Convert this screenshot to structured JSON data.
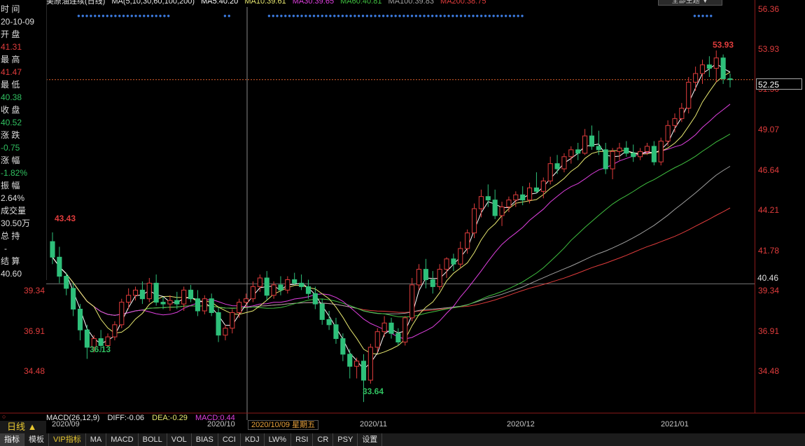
{
  "title": "美原油连续(日线)",
  "ma_legend": {
    "main": "MA(5,10,30,60,100,200)",
    "ma5": "MA5:40.20",
    "ma10": "MA10:39.61",
    "ma30": "MA30:39.65",
    "ma60": "MA60:40.81",
    "ma100": "MA100:39.83",
    "ma200": "MA200:38.75",
    "colors": {
      "ma5": "#ffffff",
      "ma10": "#e8e870",
      "ma30": "#e040e0",
      "ma60": "#40c040",
      "ma100": "#a0a0a0",
      "ma200": "#e03c3c"
    }
  },
  "theme_button": "全部主题 ▼",
  "info": {
    "time_label": "时 间",
    "time_value": "20-10-09",
    "open_label": "开 盘",
    "open_value": "41.31",
    "high_label": "最 高",
    "high_value": "41.47",
    "low_label": "最 低",
    "low_value": "40.38",
    "close_label": "收 盘",
    "close_value": "40.52",
    "change_label": "涨 跌",
    "change_value": "-0.75",
    "pct_label": "涨 幅",
    "pct_value": "-1.82%",
    "amp_label": "振 幅",
    "amp_value": "2.64%",
    "volume_label": "成交量",
    "volume_value": "30.50万",
    "oi_label": "总 持",
    "oi_value": "-",
    "settle_label": "结 算",
    "settle_value": "40.60"
  },
  "y_axis_right": [
    "56.36",
    "53.93",
    "51.50",
    "49.07",
    "46.64",
    "44.21",
    "41.78",
    "39.34",
    "36.91",
    "34.48"
  ],
  "y_axis_left": [
    "39.34",
    "36.91",
    "34.48"
  ],
  "current_price": "52.25",
  "reference_price": "40.46",
  "peak_labels": {
    "high_left": "43.43",
    "low_left": "36.13",
    "low_mid": "33.64",
    "high_right": "53.93"
  },
  "macd": {
    "label": "MACD(26,12,9)",
    "diff": "DIFF:-0.06",
    "dea": "DEA:-0.29",
    "macd": "MACD:0.44"
  },
  "x_axis": [
    "2020/09",
    "2020/10",
    "2020/11",
    "2020/12",
    "2021/01"
  ],
  "cursor_date": "2020/10/09 星期五",
  "period_button": "日线 ▲",
  "bottom_tabs": [
    "指标",
    "模板",
    "VIP指标",
    "MA",
    "MACD",
    "BOLL",
    "VOL",
    "BIAS",
    "CCI",
    "KDJ",
    "LW%",
    "RSI",
    "CR",
    "PSY",
    "设置"
  ],
  "chart_data": {
    "type": "candlestick",
    "title": "美原油连续(日线)",
    "ylim": [
      33.0,
      56.36
    ],
    "candles": [
      [
        42.9,
        43.43,
        41.6,
        42.0
      ],
      [
        42.0,
        42.6,
        40.5,
        40.9
      ],
      [
        40.9,
        41.1,
        39.8,
        40.2
      ],
      [
        40.2,
        40.5,
        38.6,
        39.0
      ],
      [
        39.0,
        39.3,
        37.2,
        37.8
      ],
      [
        37.8,
        38.1,
        36.13,
        36.8
      ],
      [
        36.8,
        37.5,
        36.5,
        37.3
      ],
      [
        37.3,
        37.8,
        36.6,
        36.9
      ],
      [
        36.9,
        37.6,
        36.8,
        37.4
      ],
      [
        37.4,
        38.3,
        37.2,
        38.1
      ],
      [
        38.1,
        39.6,
        37.9,
        39.4
      ],
      [
        39.4,
        40.2,
        39.0,
        39.8
      ],
      [
        39.8,
        40.3,
        39.5,
        40.1
      ],
      [
        40.1,
        40.6,
        39.3,
        39.6
      ],
      [
        39.6,
        40.8,
        39.4,
        40.5
      ],
      [
        40.5,
        41.0,
        39.2,
        39.4
      ],
      [
        39.4,
        39.7,
        39.0,
        39.3
      ],
      [
        39.3,
        39.8,
        38.9,
        39.5
      ],
      [
        39.5,
        40.0,
        39.0,
        39.3
      ],
      [
        39.3,
        40.3,
        38.9,
        40.1
      ],
      [
        40.1,
        40.4,
        39.4,
        39.6
      ],
      [
        39.6,
        40.1,
        38.6,
        38.9
      ],
      [
        38.9,
        39.8,
        38.7,
        39.6
      ],
      [
        39.6,
        39.9,
        38.6,
        38.8
      ],
      [
        38.8,
        39.1,
        37.1,
        37.5
      ],
      [
        37.5,
        38.1,
        37.2,
        37.9
      ],
      [
        37.9,
        39.0,
        37.6,
        38.8
      ],
      [
        38.8,
        39.6,
        38.5,
        39.4
      ],
      [
        39.4,
        39.9,
        39.1,
        39.6
      ],
      [
        39.6,
        40.6,
        39.4,
        40.3
      ],
      [
        40.3,
        41.0,
        40.0,
        40.8
      ],
      [
        40.8,
        41.2,
        39.5,
        39.8
      ],
      [
        39.8,
        40.6,
        39.6,
        40.4
      ],
      [
        40.4,
        40.9,
        39.8,
        40.1
      ],
      [
        40.1,
        40.9,
        39.9,
        40.7
      ],
      [
        40.7,
        41.1,
        40.4,
        40.5
      ],
      [
        40.5,
        41.0,
        40.1,
        40.3
      ],
      [
        40.3,
        40.7,
        39.6,
        39.9
      ],
      [
        39.9,
        40.3,
        39.0,
        39.3
      ],
      [
        39.3,
        39.6,
        38.1,
        38.4
      ],
      [
        38.4,
        38.9,
        37.8,
        38.1
      ],
      [
        38.1,
        38.5,
        37.0,
        37.3
      ],
      [
        37.3,
        37.6,
        36.0,
        36.4
      ],
      [
        36.4,
        36.7,
        35.0,
        35.7
      ],
      [
        35.7,
        36.2,
        35.0,
        36.0
      ],
      [
        36.0,
        36.4,
        33.64,
        34.9
      ],
      [
        34.9,
        37.0,
        34.7,
        36.8
      ],
      [
        36.8,
        37.9,
        36.5,
        37.7
      ],
      [
        37.7,
        38.6,
        37.4,
        38.2
      ],
      [
        38.2,
        38.5,
        37.3,
        37.6
      ],
      [
        37.6,
        37.9,
        36.9,
        37.1
      ],
      [
        37.1,
        38.6,
        36.9,
        38.5
      ],
      [
        38.5,
        40.8,
        38.3,
        40.4
      ],
      [
        40.4,
        41.6,
        40.1,
        41.3
      ],
      [
        41.3,
        41.9,
        40.2,
        40.7
      ],
      [
        40.7,
        41.2,
        39.9,
        40.3
      ],
      [
        40.3,
        41.6,
        40.1,
        41.3
      ],
      [
        41.3,
        42.0,
        40.8,
        41.9
      ],
      [
        41.9,
        42.2,
        41.2,
        41.6
      ],
      [
        41.6,
        42.9,
        41.4,
        42.5
      ],
      [
        42.5,
        43.6,
        42.2,
        43.4
      ],
      [
        43.4,
        45.1,
        43.1,
        44.8
      ],
      [
        44.8,
        45.9,
        44.3,
        45.5
      ],
      [
        45.5,
        46.2,
        44.9,
        45.3
      ],
      [
        45.3,
        45.9,
        44.2,
        44.4
      ],
      [
        44.4,
        45.2,
        43.8,
        44.9
      ],
      [
        44.9,
        45.5,
        44.6,
        45.3
      ],
      [
        45.3,
        45.8,
        44.9,
        45.6
      ],
      [
        45.6,
        46.1,
        45.0,
        45.3
      ],
      [
        45.3,
        46.3,
        45.1,
        46.0
      ],
      [
        46.0,
        46.9,
        45.7,
        45.8
      ],
      [
        45.8,
        46.6,
        45.4,
        46.4
      ],
      [
        46.4,
        47.8,
        46.2,
        47.4
      ],
      [
        47.4,
        47.9,
        46.8,
        47.1
      ],
      [
        47.1,
        48.0,
        46.9,
        47.8
      ],
      [
        47.8,
        48.4,
        47.4,
        48.2
      ],
      [
        48.2,
        48.6,
        47.6,
        48.0
      ],
      [
        48.0,
        49.4,
        47.9,
        49.0
      ],
      [
        49.0,
        49.6,
        48.2,
        48.4
      ],
      [
        48.4,
        49.3,
        47.9,
        48.2
      ],
      [
        48.2,
        48.6,
        46.8,
        47.1
      ],
      [
        47.1,
        48.3,
        46.5,
        48.1
      ],
      [
        48.1,
        48.6,
        47.6,
        48.3
      ],
      [
        48.3,
        48.7,
        47.8,
        48.0
      ],
      [
        48.0,
        48.5,
        47.5,
        47.8
      ],
      [
        47.8,
        48.3,
        47.6,
        48.1
      ],
      [
        48.1,
        48.6,
        47.9,
        48.4
      ],
      [
        48.4,
        48.7,
        47.3,
        47.5
      ],
      [
        47.5,
        48.9,
        47.3,
        48.7
      ],
      [
        48.7,
        49.9,
        48.4,
        49.6
      ],
      [
        49.6,
        50.3,
        49.2,
        50.0
      ],
      [
        50.0,
        50.9,
        49.8,
        50.6
      ],
      [
        50.6,
        52.4,
        50.3,
        52.1
      ],
      [
        52.1,
        53.0,
        51.6,
        52.6
      ],
      [
        52.6,
        53.4,
        52.0,
        53.1
      ],
      [
        53.1,
        53.6,
        52.4,
        52.9
      ],
      [
        52.9,
        53.93,
        52.1,
        53.5
      ],
      [
        53.5,
        53.7,
        52.0,
        52.3
      ],
      [
        52.3,
        52.6,
        51.8,
        52.25
      ]
    ]
  }
}
